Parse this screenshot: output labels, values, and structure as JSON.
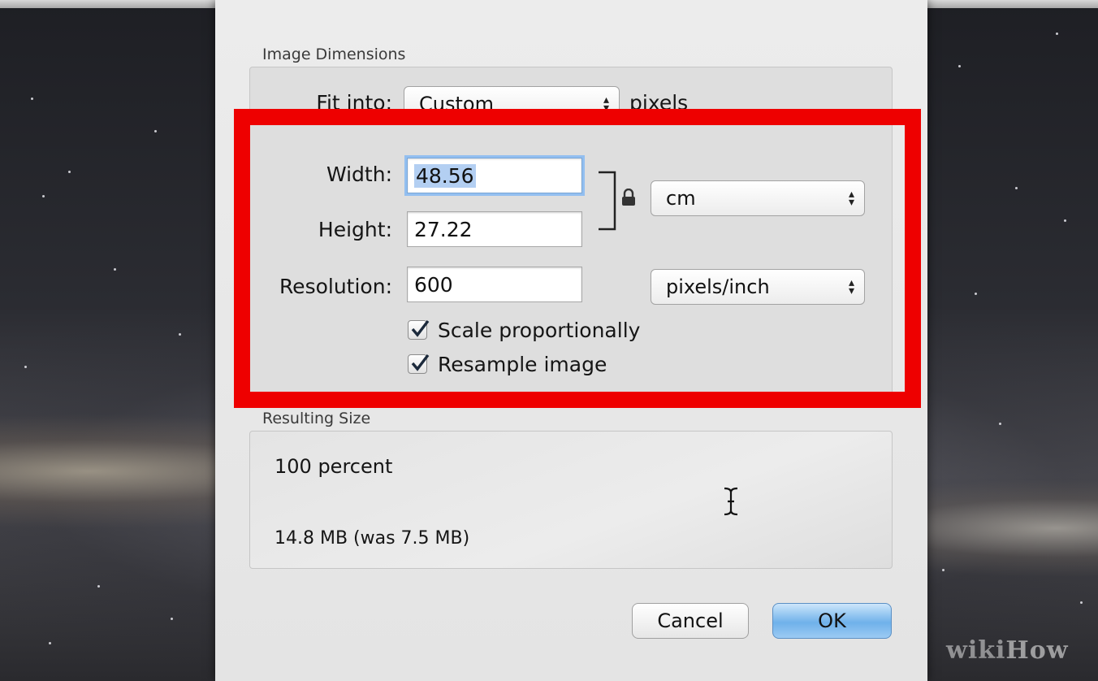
{
  "dimensions": {
    "title": "Image Dimensions",
    "fit_into_label": "Fit into:",
    "fit_into_value": "Custom",
    "fit_into_units": "pixels",
    "width_label": "Width:",
    "width_value": "48.56",
    "height_label": "Height:",
    "height_value": "27.22",
    "size_unit": "cm",
    "resolution_label": "Resolution:",
    "resolution_value": "600",
    "resolution_unit": "pixels/inch",
    "scale_label": "Scale proportionally",
    "scale_checked": true,
    "resample_label": "Resample image",
    "resample_checked": true
  },
  "result": {
    "title": "Resulting Size",
    "percent": "100 percent",
    "size": "14.8 MB (was 7.5 MB)"
  },
  "buttons": {
    "cancel": "Cancel",
    "ok": "OK"
  },
  "watermark": {
    "wiki": "wiki",
    "how": "How"
  },
  "colors": {
    "highlight": "#ee0000",
    "ok_button": "#6fb1ea"
  },
  "icons": [
    "lock-icon",
    "chevron-updown-icon",
    "checkmark-icon",
    "text-cursor-icon"
  ]
}
